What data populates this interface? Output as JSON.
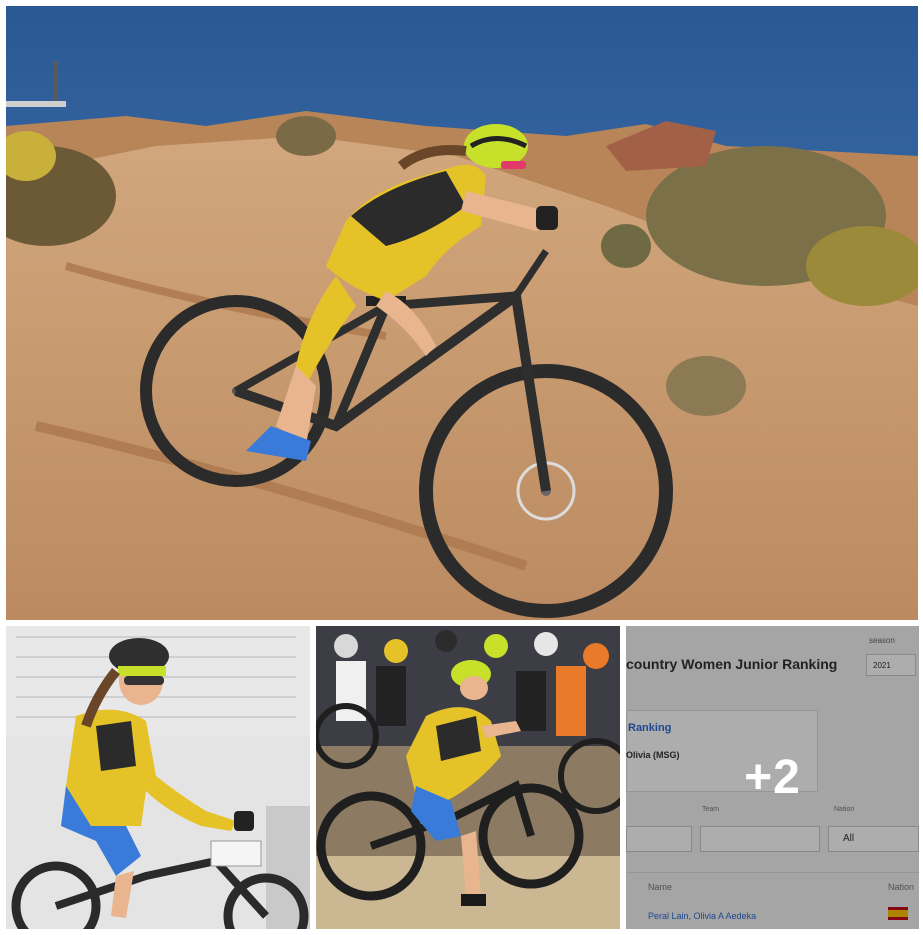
{
  "gallery": {
    "more_count": "+2",
    "photos": [
      {
        "subject": "rider-descending-dirt-slope"
      },
      {
        "subject": "rider-portrait-white-wall"
      },
      {
        "subject": "race-start-group-riders"
      },
      {
        "subject": "ranking-screenshot"
      }
    ]
  },
  "ranking_screenshot": {
    "title": "country Women Junior Ranking",
    "season_label": "season",
    "season_value": "2021",
    "ranking_link": "Ranking",
    "athlete": "Olivia (MSG)",
    "filter_all": "All",
    "col_team": "Team",
    "col_nation": "Nation",
    "col_name": "Name",
    "col_nation_row": "Nation",
    "row_name": "Peral Lain, Olivia A Aedeka"
  },
  "colors": {
    "sky": "#2e5f9b",
    "dirt": "#c9976c",
    "jersey_yellow": "#e6c229",
    "helmet_green": "#c7e02a",
    "overlay": "rgba(0,0,0,0.32)"
  }
}
